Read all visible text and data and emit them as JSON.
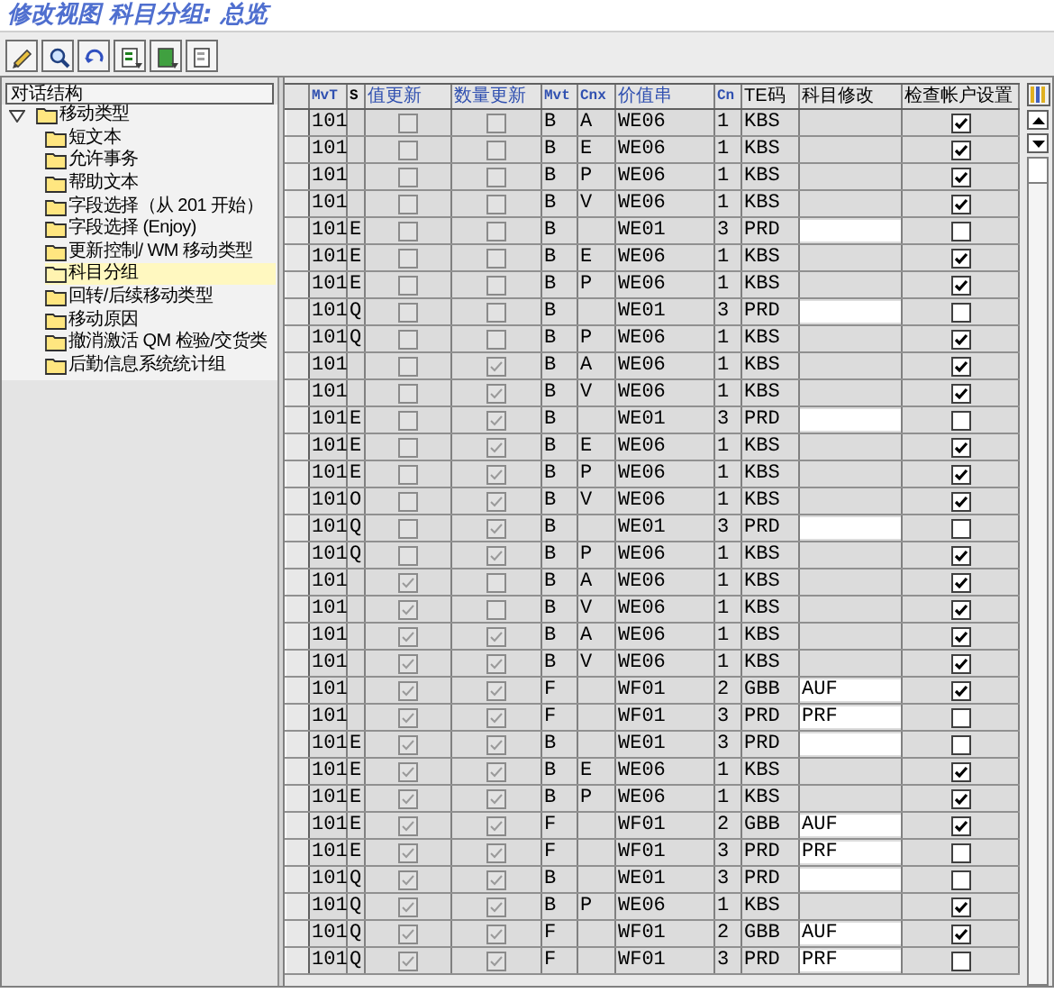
{
  "window": {
    "title": "修改视图 科目分组: 总览"
  },
  "toolbar": {
    "buttons": [
      {
        "kind": "edit"
      },
      {
        "kind": "display"
      },
      {
        "kind": "undo"
      },
      {
        "kind": "select"
      },
      {
        "kind": "select-block"
      },
      {
        "kind": "deselect"
      }
    ]
  },
  "dialog_structure": {
    "header": "对话结构",
    "items": [
      {
        "label": "移动类型",
        "expanded": true,
        "selected": false,
        "children": [
          {
            "label": "短文本",
            "selected": false
          },
          {
            "label": "允许事务",
            "selected": false
          },
          {
            "label": "帮助文本",
            "selected": false
          },
          {
            "label": "字段选择（从 201 开始）",
            "selected": false
          },
          {
            "label": "字段选择 (Enjoy)",
            "selected": false
          },
          {
            "label": "更新控制/ WM 移动类型",
            "selected": false
          },
          {
            "label": "科目分组",
            "selected": true
          },
          {
            "label": "回转/后续移动类型",
            "selected": false
          },
          {
            "label": "移动原因",
            "selected": false
          },
          {
            "label": "撤消激活 QM 检验/交货类",
            "selected": false
          },
          {
            "label": "后勤信息系统统计组",
            "selected": false
          }
        ]
      }
    ]
  },
  "table": {
    "columns": [
      "MvT",
      "S",
      "值更新",
      "数量更新",
      "Mvt",
      "Cnx",
      "价值串",
      "Cn",
      "TE码",
      "科目修改",
      "检查帐户设置"
    ],
    "rows": [
      {
        "mvt": "101",
        "s": "",
        "value_update": false,
        "qty_update": false,
        "mvt2": "B",
        "cnx": "A",
        "value_string": "WE06",
        "cn": "1",
        "te": "KBS",
        "acct_mod": "",
        "editable": false,
        "check_acct": true
      },
      {
        "mvt": "101",
        "s": "",
        "value_update": false,
        "qty_update": false,
        "mvt2": "B",
        "cnx": "E",
        "value_string": "WE06",
        "cn": "1",
        "te": "KBS",
        "acct_mod": "",
        "editable": false,
        "check_acct": true
      },
      {
        "mvt": "101",
        "s": "",
        "value_update": false,
        "qty_update": false,
        "mvt2": "B",
        "cnx": "P",
        "value_string": "WE06",
        "cn": "1",
        "te": "KBS",
        "acct_mod": "",
        "editable": false,
        "check_acct": true
      },
      {
        "mvt": "101",
        "s": "",
        "value_update": false,
        "qty_update": false,
        "mvt2": "B",
        "cnx": "V",
        "value_string": "WE06",
        "cn": "1",
        "te": "KBS",
        "acct_mod": "",
        "editable": false,
        "check_acct": true
      },
      {
        "mvt": "101",
        "s": "E",
        "value_update": false,
        "qty_update": false,
        "mvt2": "B",
        "cnx": "",
        "value_string": "WE01",
        "cn": "3",
        "te": "PRD",
        "acct_mod": "",
        "editable": true,
        "check_acct": false
      },
      {
        "mvt": "101",
        "s": "E",
        "value_update": false,
        "qty_update": false,
        "mvt2": "B",
        "cnx": "E",
        "value_string": "WE06",
        "cn": "1",
        "te": "KBS",
        "acct_mod": "",
        "editable": false,
        "check_acct": true
      },
      {
        "mvt": "101",
        "s": "E",
        "value_update": false,
        "qty_update": false,
        "mvt2": "B",
        "cnx": "P",
        "value_string": "WE06",
        "cn": "1",
        "te": "KBS",
        "acct_mod": "",
        "editable": false,
        "check_acct": true
      },
      {
        "mvt": "101",
        "s": "Q",
        "value_update": false,
        "qty_update": false,
        "mvt2": "B",
        "cnx": "",
        "value_string": "WE01",
        "cn": "3",
        "te": "PRD",
        "acct_mod": "",
        "editable": true,
        "check_acct": false
      },
      {
        "mvt": "101",
        "s": "Q",
        "value_update": false,
        "qty_update": false,
        "mvt2": "B",
        "cnx": "P",
        "value_string": "WE06",
        "cn": "1",
        "te": "KBS",
        "acct_mod": "",
        "editable": false,
        "check_acct": true
      },
      {
        "mvt": "101",
        "s": "",
        "value_update": false,
        "qty_update": true,
        "mvt2": "B",
        "cnx": "A",
        "value_string": "WE06",
        "cn": "1",
        "te": "KBS",
        "acct_mod": "",
        "editable": false,
        "check_acct": true
      },
      {
        "mvt": "101",
        "s": "",
        "value_update": false,
        "qty_update": true,
        "mvt2": "B",
        "cnx": "V",
        "value_string": "WE06",
        "cn": "1",
        "te": "KBS",
        "acct_mod": "",
        "editable": false,
        "check_acct": true
      },
      {
        "mvt": "101",
        "s": "E",
        "value_update": false,
        "qty_update": true,
        "mvt2": "B",
        "cnx": "",
        "value_string": "WE01",
        "cn": "3",
        "te": "PRD",
        "acct_mod": "",
        "editable": true,
        "check_acct": false
      },
      {
        "mvt": "101",
        "s": "E",
        "value_update": false,
        "qty_update": true,
        "mvt2": "B",
        "cnx": "E",
        "value_string": "WE06",
        "cn": "1",
        "te": "KBS",
        "acct_mod": "",
        "editable": false,
        "check_acct": true
      },
      {
        "mvt": "101",
        "s": "E",
        "value_update": false,
        "qty_update": true,
        "mvt2": "B",
        "cnx": "P",
        "value_string": "WE06",
        "cn": "1",
        "te": "KBS",
        "acct_mod": "",
        "editable": false,
        "check_acct": true
      },
      {
        "mvt": "101",
        "s": "O",
        "value_update": false,
        "qty_update": true,
        "mvt2": "B",
        "cnx": "V",
        "value_string": "WE06",
        "cn": "1",
        "te": "KBS",
        "acct_mod": "",
        "editable": false,
        "check_acct": true
      },
      {
        "mvt": "101",
        "s": "Q",
        "value_update": false,
        "qty_update": true,
        "mvt2": "B",
        "cnx": "",
        "value_string": "WE01",
        "cn": "3",
        "te": "PRD",
        "acct_mod": "",
        "editable": true,
        "check_acct": false
      },
      {
        "mvt": "101",
        "s": "Q",
        "value_update": false,
        "qty_update": true,
        "mvt2": "B",
        "cnx": "P",
        "value_string": "WE06",
        "cn": "1",
        "te": "KBS",
        "acct_mod": "",
        "editable": false,
        "check_acct": true
      },
      {
        "mvt": "101",
        "s": "",
        "value_update": true,
        "qty_update": false,
        "mvt2": "B",
        "cnx": "A",
        "value_string": "WE06",
        "cn": "1",
        "te": "KBS",
        "acct_mod": "",
        "editable": false,
        "check_acct": true
      },
      {
        "mvt": "101",
        "s": "",
        "value_update": true,
        "qty_update": false,
        "mvt2": "B",
        "cnx": "V",
        "value_string": "WE06",
        "cn": "1",
        "te": "KBS",
        "acct_mod": "",
        "editable": false,
        "check_acct": true
      },
      {
        "mvt": "101",
        "s": "",
        "value_update": true,
        "qty_update": true,
        "mvt2": "B",
        "cnx": "A",
        "value_string": "WE06",
        "cn": "1",
        "te": "KBS",
        "acct_mod": "",
        "editable": false,
        "check_acct": true
      },
      {
        "mvt": "101",
        "s": "",
        "value_update": true,
        "qty_update": true,
        "mvt2": "B",
        "cnx": "V",
        "value_string": "WE06",
        "cn": "1",
        "te": "KBS",
        "acct_mod": "",
        "editable": false,
        "check_acct": true
      },
      {
        "mvt": "101",
        "s": "",
        "value_update": true,
        "qty_update": true,
        "mvt2": "F",
        "cnx": "",
        "value_string": "WF01",
        "cn": "2",
        "te": "GBB",
        "acct_mod": "AUF",
        "editable": true,
        "check_acct": true
      },
      {
        "mvt": "101",
        "s": "",
        "value_update": true,
        "qty_update": true,
        "mvt2": "F",
        "cnx": "",
        "value_string": "WF01",
        "cn": "3",
        "te": "PRD",
        "acct_mod": "PRF",
        "editable": true,
        "check_acct": false
      },
      {
        "mvt": "101",
        "s": "E",
        "value_update": true,
        "qty_update": true,
        "mvt2": "B",
        "cnx": "",
        "value_string": "WE01",
        "cn": "3",
        "te": "PRD",
        "acct_mod": "",
        "editable": true,
        "check_acct": false
      },
      {
        "mvt": "101",
        "s": "E",
        "value_update": true,
        "qty_update": true,
        "mvt2": "B",
        "cnx": "E",
        "value_string": "WE06",
        "cn": "1",
        "te": "KBS",
        "acct_mod": "",
        "editable": false,
        "check_acct": true
      },
      {
        "mvt": "101",
        "s": "E",
        "value_update": true,
        "qty_update": true,
        "mvt2": "B",
        "cnx": "P",
        "value_string": "WE06",
        "cn": "1",
        "te": "KBS",
        "acct_mod": "",
        "editable": false,
        "check_acct": true
      },
      {
        "mvt": "101",
        "s": "E",
        "value_update": true,
        "qty_update": true,
        "mvt2": "F",
        "cnx": "",
        "value_string": "WF01",
        "cn": "2",
        "te": "GBB",
        "acct_mod": "AUF",
        "editable": true,
        "check_acct": true
      },
      {
        "mvt": "101",
        "s": "E",
        "value_update": true,
        "qty_update": true,
        "mvt2": "F",
        "cnx": "",
        "value_string": "WF01",
        "cn": "3",
        "te": "PRD",
        "acct_mod": "PRF",
        "editable": true,
        "check_acct": false
      },
      {
        "mvt": "101",
        "s": "Q",
        "value_update": true,
        "qty_update": true,
        "mvt2": "B",
        "cnx": "",
        "value_string": "WE01",
        "cn": "3",
        "te": "PRD",
        "acct_mod": "",
        "editable": true,
        "check_acct": false
      },
      {
        "mvt": "101",
        "s": "Q",
        "value_update": true,
        "qty_update": true,
        "mvt2": "B",
        "cnx": "P",
        "value_string": "WE06",
        "cn": "1",
        "te": "KBS",
        "acct_mod": "",
        "editable": false,
        "check_acct": true
      },
      {
        "mvt": "101",
        "s": "Q",
        "value_update": true,
        "qty_update": true,
        "mvt2": "F",
        "cnx": "",
        "value_string": "WF01",
        "cn": "2",
        "te": "GBB",
        "acct_mod": "AUF",
        "editable": true,
        "check_acct": true
      },
      {
        "mvt": "101",
        "s": "Q",
        "value_update": true,
        "qty_update": true,
        "mvt2": "F",
        "cnx": "",
        "value_string": "WF01",
        "cn": "3",
        "te": "PRD",
        "acct_mod": "PRF",
        "editable": true,
        "check_acct": false
      }
    ]
  }
}
